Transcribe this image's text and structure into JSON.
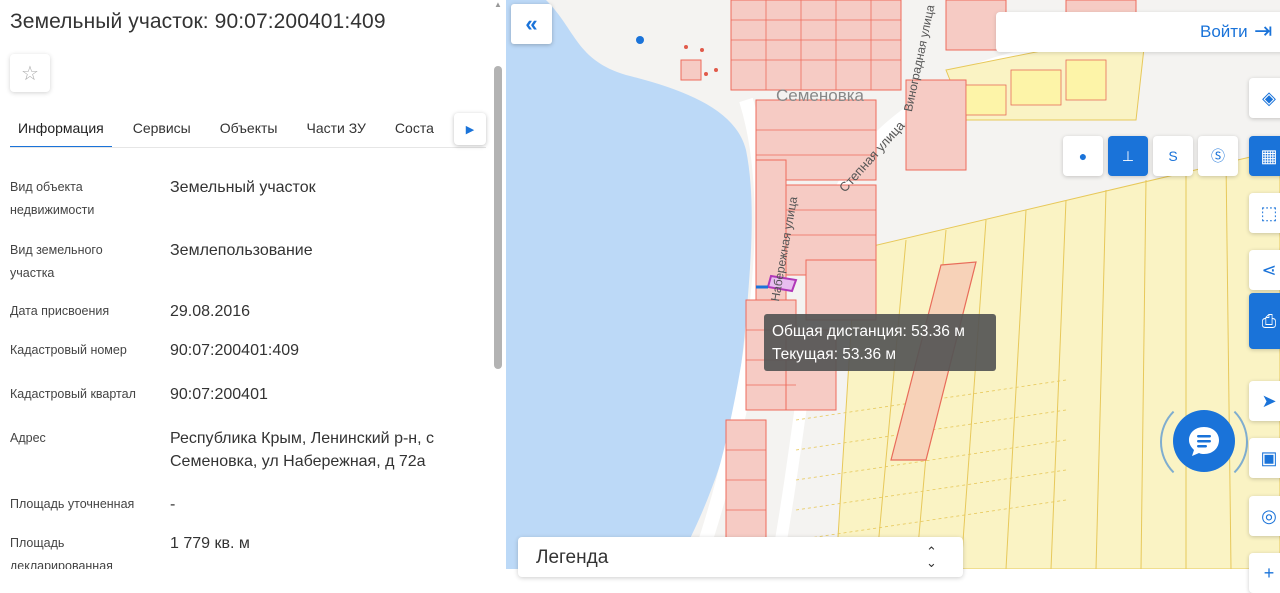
{
  "panel": {
    "title": "Земельный участок: 90:07:200401:409",
    "tabs": [
      "Информация",
      "Сервисы",
      "Объекты",
      "Части ЗУ",
      "Соста"
    ],
    "active_tab": "Информация",
    "fields": [
      {
        "label": "Вид объекта недвижимости",
        "value": "Земельный участок"
      },
      {
        "label": "Вид земельного участка",
        "value": "Землепользование"
      },
      {
        "label": "Дата присвоения",
        "value": "29.08.2016"
      },
      {
        "label": "Кадастровый номер",
        "value": "90:07:200401:409"
      },
      {
        "label": "Кадастровый квартал",
        "value": "90:07:200401"
      },
      {
        "label": "Адрес",
        "value": "Республика Крым, Ленинский р-н, с Семеновка, ул Набережная, д 72а"
      },
      {
        "label": "Площадь уточненная",
        "value": "-"
      },
      {
        "label": "Площадь декларированная",
        "value": "1 779 кв. м"
      }
    ]
  },
  "map": {
    "login_label": "Войти",
    "place_label": "Семеновка",
    "street_labels": [
      "Виноградная улица",
      "Степная улица",
      "Набережная улица"
    ],
    "tooltip": {
      "total": "Общая дистанция: 53.36 м",
      "current": "Текущая: 53.36 м"
    },
    "legend_label": "Легенда",
    "colors": {
      "water": "#bcd9f7",
      "parcel_stroke": "#ee6b5c",
      "zone_fill": "#faf3c4",
      "zone_stroke": "#e7c85a",
      "accent": "#1a73d9",
      "highlight": "#b038b8"
    }
  }
}
